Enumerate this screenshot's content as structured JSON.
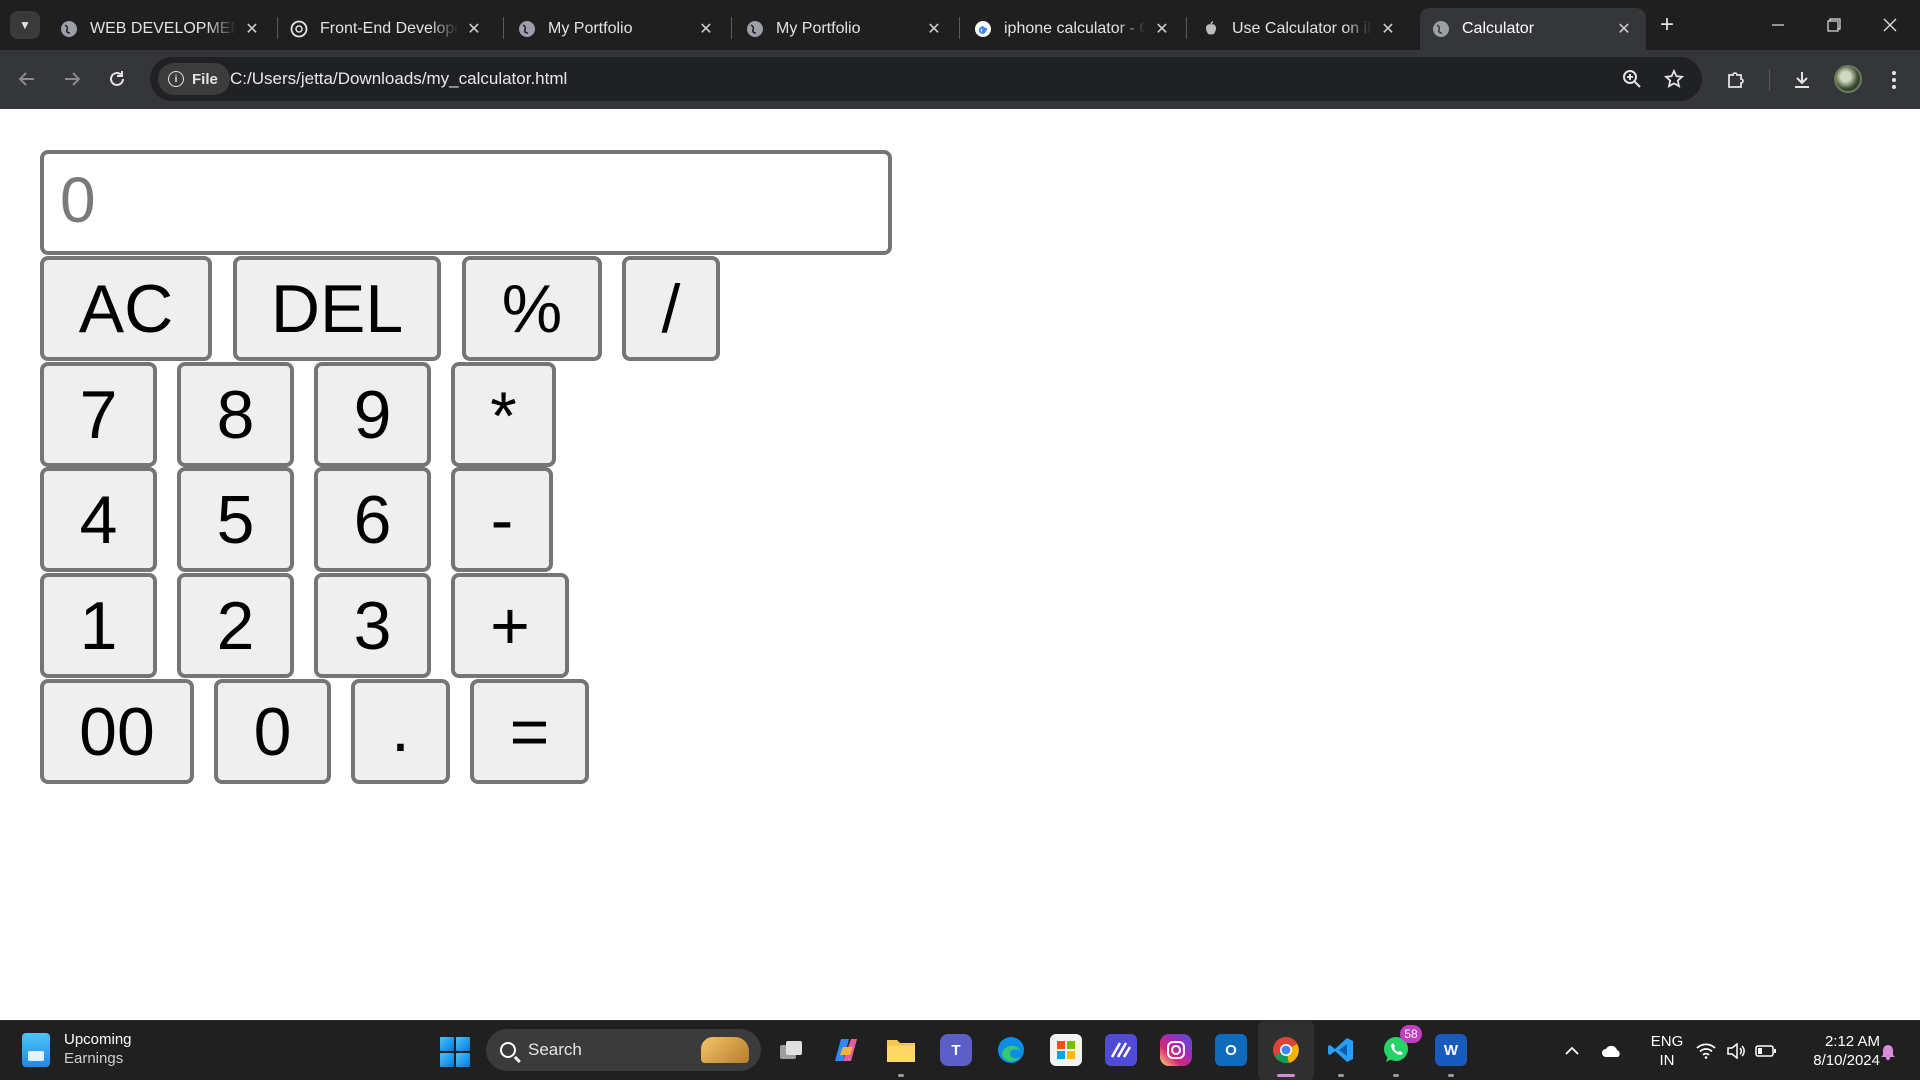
{
  "browser": {
    "tabs": [
      {
        "title": "WEB DEVELOPMENT",
        "favicon": "globe-icon",
        "active": false
      },
      {
        "title": "Front-End Developer",
        "favicon": "chatgpt-icon",
        "active": false
      },
      {
        "title": "My Portfolio",
        "favicon": "globe-icon",
        "active": false
      },
      {
        "title": "My Portfolio",
        "favicon": "globe-icon",
        "active": false
      },
      {
        "title": "iphone calculator - G",
        "favicon": "google-icon",
        "active": false
      },
      {
        "title": "Use Calculator on iPh",
        "favicon": "apple-icon",
        "active": false
      },
      {
        "title": "Calculator",
        "favicon": "globe-icon",
        "active": true
      }
    ],
    "address": {
      "chip_label": "File",
      "url": "C:/Users/jetta/Downloads/my_calculator.html"
    }
  },
  "calculator": {
    "display_value": "0",
    "keys": {
      "ac": "AC",
      "del": "DEL",
      "percent": "%",
      "divide": "/",
      "seven": "7",
      "eight": "8",
      "nine": "9",
      "multiply": "*",
      "four": "4",
      "five": "5",
      "six": "6",
      "minus": "-",
      "one": "1",
      "two": "2",
      "three": "3",
      "plus": "+",
      "double_zero": "00",
      "zero": "0",
      "decimal": ".",
      "equals": "="
    }
  },
  "taskbar": {
    "widget": {
      "title": "Upcoming",
      "subtitle": "Earnings"
    },
    "search_label": "Search",
    "whatsapp_badge": "58",
    "tray": {
      "lang_line1": "ENG",
      "lang_line2": "IN",
      "time": "2:12 AM",
      "date": "8/10/2024"
    }
  },
  "colors": {
    "tabbar_bg": "#1f1f1f",
    "toolbar_bg": "#35363a",
    "key_bg": "#efefef",
    "key_border": "#757575",
    "display_text": "#7a7a7a",
    "taskbar_bg": "#202020"
  }
}
